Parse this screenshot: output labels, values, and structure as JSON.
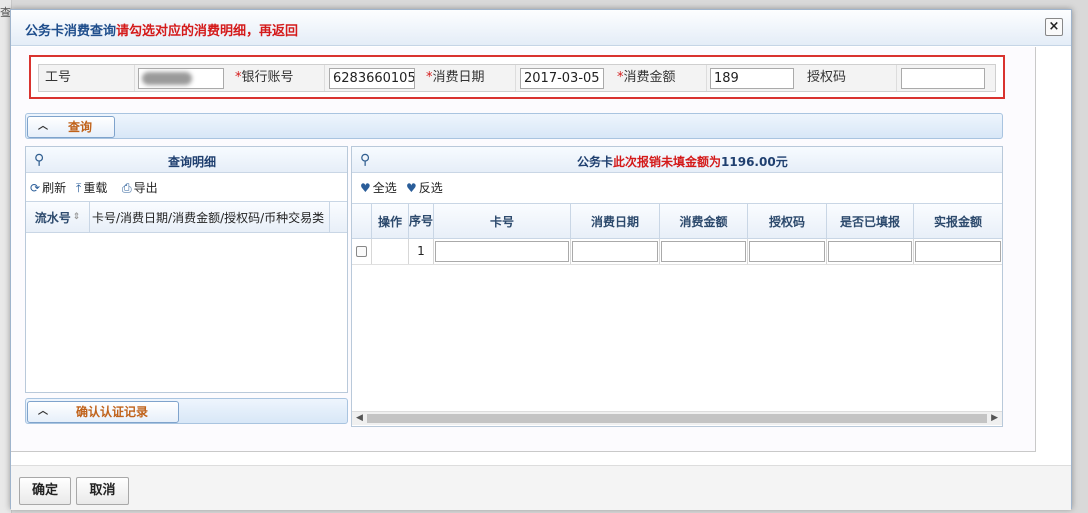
{
  "background": {
    "left_text": "查"
  },
  "dialog": {
    "title_main": "公务卡消费查询",
    "title_hint": "请勾选对应的消费明细，再返回",
    "close_label": "×"
  },
  "form": {
    "fields": [
      {
        "label": "工号",
        "required": false,
        "value": ""
      },
      {
        "label": "银行账号",
        "required": true,
        "value": "6283660105"
      },
      {
        "label": "消费日期",
        "required": true,
        "value": "2017-03-05"
      },
      {
        "label": "消费金额",
        "required": true,
        "value": "189"
      },
      {
        "label": "授权码",
        "required": false,
        "value": ""
      }
    ],
    "required_mark": "*"
  },
  "query_tab": {
    "label": "查询"
  },
  "left_panel": {
    "title": "查询明细",
    "toolbar": {
      "refresh": "刷新",
      "reload": "重载",
      "export": "导出"
    },
    "columns": [
      "流水号",
      "卡号/消费日期/消费金额/授权码/币种交易类"
    ]
  },
  "confirm_tab": {
    "label": "确认认证记录"
  },
  "right_panel": {
    "title_prefix": "公务卡",
    "title_red": "此次报销未填金额为",
    "title_amount": "1196.00元",
    "toolbar": {
      "select_all": "全选",
      "invert": "反选"
    },
    "columns": [
      "操作",
      "序号",
      "卡号",
      "消费日期",
      "消费金额",
      "授权码",
      "是否已填报",
      "实报金额"
    ],
    "rows": [
      {
        "index": "1"
      }
    ]
  },
  "footer": {
    "ok": "确定",
    "cancel": "取消"
  },
  "colors": {
    "accent": "#1f4e8c",
    "warning": "#d41a1a",
    "tab_text": "#c0621a",
    "form_border": "#d9332f"
  }
}
